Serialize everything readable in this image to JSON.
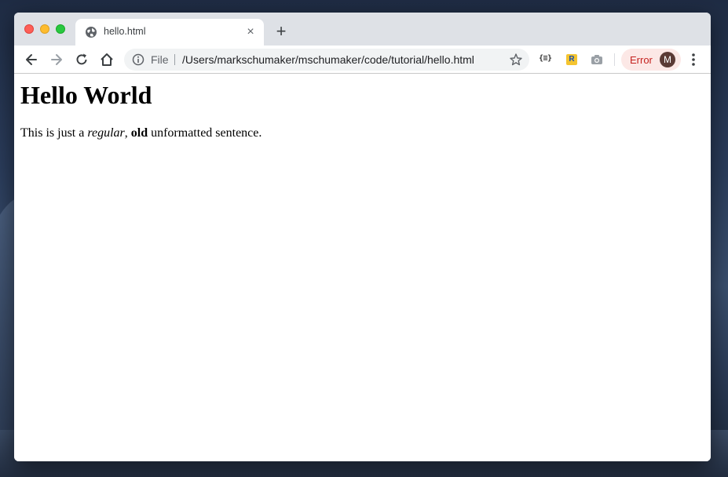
{
  "tab": {
    "title": "hello.html",
    "close": "×"
  },
  "new_tab": "+",
  "omnibox": {
    "scheme_label": "File",
    "url": "/Users/markschumaker/mschumaker/code/tutorial/hello.html"
  },
  "extensions": {
    "json_label": "{≡}",
    "r_label": "R"
  },
  "profile": {
    "error_label": "Error",
    "avatar_initial": "M"
  },
  "page": {
    "heading": "Hello World",
    "sentence": {
      "part1": "This is just a ",
      "italic": "regular",
      "part2": ", ",
      "bold": "old",
      "part3": " unformatted sentence."
    }
  },
  "colors": {
    "error_bg": "#fce8e6",
    "error_text": "#c5221f",
    "avatar_bg": "#5b3a35"
  }
}
